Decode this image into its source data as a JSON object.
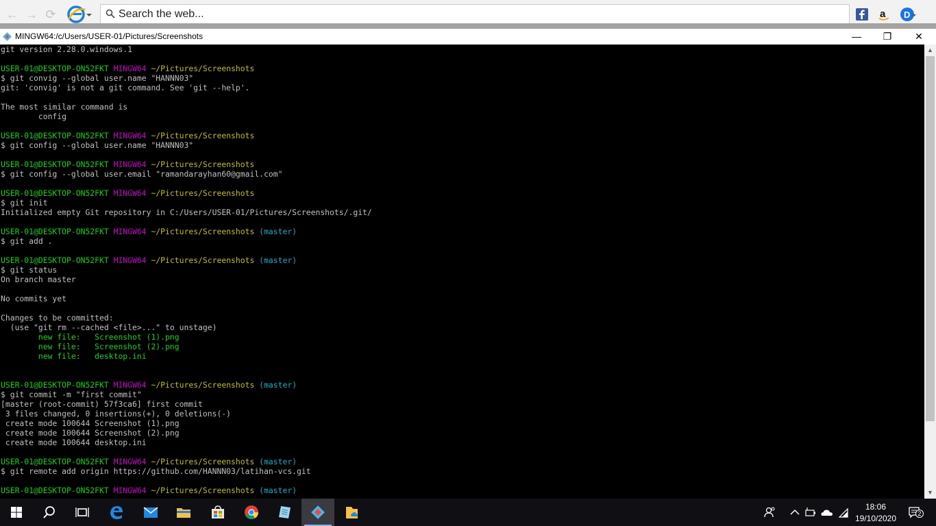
{
  "browser": {
    "back_glyph": "←",
    "forward_glyph": "→",
    "refresh_glyph": "⟳",
    "search_placeholder": "Search the web...",
    "ext_icons": [
      "facebook-icon",
      "amazon-icon",
      "d-extension-icon"
    ]
  },
  "terminal": {
    "title": "MINGW64:/c/Users/USER-01/Pictures/Screenshots",
    "controls": {
      "minimize": "—",
      "maximize": "❐",
      "close": "✕"
    },
    "lines": [
      [
        {
          "t": "git version 2.28.0.windows.1",
          "c": ""
        }
      ],
      [],
      [
        {
          "t": "USER-01@DESKTOP-ON52FKT ",
          "c": "green"
        },
        {
          "t": "MINGW64 ",
          "c": "purple"
        },
        {
          "t": "~/Pictures/Screenshots",
          "c": "yellow"
        }
      ],
      [
        {
          "t": "$ git convig --global user.name \"HANNN03\"",
          "c": ""
        }
      ],
      [
        {
          "t": "git: 'convig' is not a git command. See 'git --help'.",
          "c": ""
        }
      ],
      [],
      [
        {
          "t": "The most similar command is",
          "c": ""
        }
      ],
      [
        {
          "t": "        config",
          "c": ""
        }
      ],
      [],
      [
        {
          "t": "USER-01@DESKTOP-ON52FKT ",
          "c": "green"
        },
        {
          "t": "MINGW64 ",
          "c": "purple"
        },
        {
          "t": "~/Pictures/Screenshots",
          "c": "yellow"
        }
      ],
      [
        {
          "t": "$ git config --global user.name \"HANNN03\"",
          "c": ""
        }
      ],
      [],
      [
        {
          "t": "USER-01@DESKTOP-ON52FKT ",
          "c": "green"
        },
        {
          "t": "MINGW64 ",
          "c": "purple"
        },
        {
          "t": "~/Pictures/Screenshots",
          "c": "yellow"
        }
      ],
      [
        {
          "t": "$ git config --global user.email \"ramandarayhan60@gmail.com\"",
          "c": ""
        }
      ],
      [],
      [
        {
          "t": "USER-01@DESKTOP-ON52FKT ",
          "c": "green"
        },
        {
          "t": "MINGW64 ",
          "c": "purple"
        },
        {
          "t": "~/Pictures/Screenshots",
          "c": "yellow"
        }
      ],
      [
        {
          "t": "$ git init",
          "c": ""
        }
      ],
      [
        {
          "t": "Initialized empty Git repository in C:/Users/USER-01/Pictures/Screenshots/.git/",
          "c": ""
        }
      ],
      [],
      [
        {
          "t": "USER-01@DESKTOP-ON52FKT ",
          "c": "green"
        },
        {
          "t": "MINGW64 ",
          "c": "purple"
        },
        {
          "t": "~/Pictures/Screenshots ",
          "c": "yellow"
        },
        {
          "t": "(master)",
          "c": "cyan"
        }
      ],
      [
        {
          "t": "$ git add .",
          "c": ""
        }
      ],
      [],
      [
        {
          "t": "USER-01@DESKTOP-ON52FKT ",
          "c": "green"
        },
        {
          "t": "MINGW64 ",
          "c": "purple"
        },
        {
          "t": "~/Pictures/Screenshots ",
          "c": "yellow"
        },
        {
          "t": "(master)",
          "c": "cyan"
        }
      ],
      [
        {
          "t": "$ git status",
          "c": ""
        }
      ],
      [
        {
          "t": "On branch master",
          "c": ""
        }
      ],
      [],
      [
        {
          "t": "No commits yet",
          "c": ""
        }
      ],
      [],
      [
        {
          "t": "Changes to be committed:",
          "c": ""
        }
      ],
      [
        {
          "t": "  (use \"git rm --cached <file>...\" to unstage)",
          "c": ""
        }
      ],
      [
        {
          "t": "        new file:   Screenshot (1).png",
          "c": "green"
        }
      ],
      [
        {
          "t": "        new file:   Screenshot (2).png",
          "c": "green"
        }
      ],
      [
        {
          "t": "        new file:   desktop.ini",
          "c": "green"
        }
      ],
      [],
      [],
      [
        {
          "t": "USER-01@DESKTOP-ON52FKT ",
          "c": "green"
        },
        {
          "t": "MINGW64 ",
          "c": "purple"
        },
        {
          "t": "~/Pictures/Screenshots ",
          "c": "yellow"
        },
        {
          "t": "(master)",
          "c": "cyan"
        }
      ],
      [
        {
          "t": "$ git commit -m \"first commit\"",
          "c": ""
        }
      ],
      [
        {
          "t": "[master (root-commit) 57f3ca6] first commit",
          "c": ""
        }
      ],
      [
        {
          "t": " 3 files changed, 0 insertions(+), 0 deletions(-)",
          "c": ""
        }
      ],
      [
        {
          "t": " create mode 100644 Screenshot (1).png",
          "c": ""
        }
      ],
      [
        {
          "t": " create mode 100644 Screenshot (2).png",
          "c": ""
        }
      ],
      [
        {
          "t": " create mode 100644 desktop.ini",
          "c": ""
        }
      ],
      [],
      [
        {
          "t": "USER-01@DESKTOP-ON52FKT ",
          "c": "green"
        },
        {
          "t": "MINGW64 ",
          "c": "purple"
        },
        {
          "t": "~/Pictures/Screenshots ",
          "c": "yellow"
        },
        {
          "t": "(master)",
          "c": "cyan"
        }
      ],
      [
        {
          "t": "$ git remote add origin https://github.com/HANNN03/latihan-vcs.git",
          "c": ""
        }
      ],
      [],
      [
        {
          "t": "USER-01@DESKTOP-ON52FKT ",
          "c": "green"
        },
        {
          "t": "MINGW64 ",
          "c": "purple"
        },
        {
          "t": "~/Pictures/Screenshots ",
          "c": "yellow"
        },
        {
          "t": "(master)",
          "c": "cyan"
        }
      ]
    ],
    "colors": {
      "green": "#00d700",
      "purple": "#c000c0",
      "yellow": "#c0c000",
      "cyan": "#00b0c8",
      "default": "#c0c0c0"
    }
  },
  "taskbar": {
    "apps": [
      "windows-start-icon",
      "search-icon",
      "task-view-icon",
      "edge-icon",
      "mail-icon",
      "file-explorer-icon",
      "store-icon",
      "chrome-icon",
      "notepad-icon",
      "git-bash-icon",
      "onedrive-folder-icon"
    ],
    "active_app": "git-bash-icon",
    "tray": [
      "people-icon",
      "chevron-up-icon",
      "battery-icon",
      "onedrive-cloud-icon",
      "wifi-icon"
    ],
    "clock": {
      "time": "18:06",
      "date": "19/10/2020"
    },
    "notification_count": "2"
  }
}
